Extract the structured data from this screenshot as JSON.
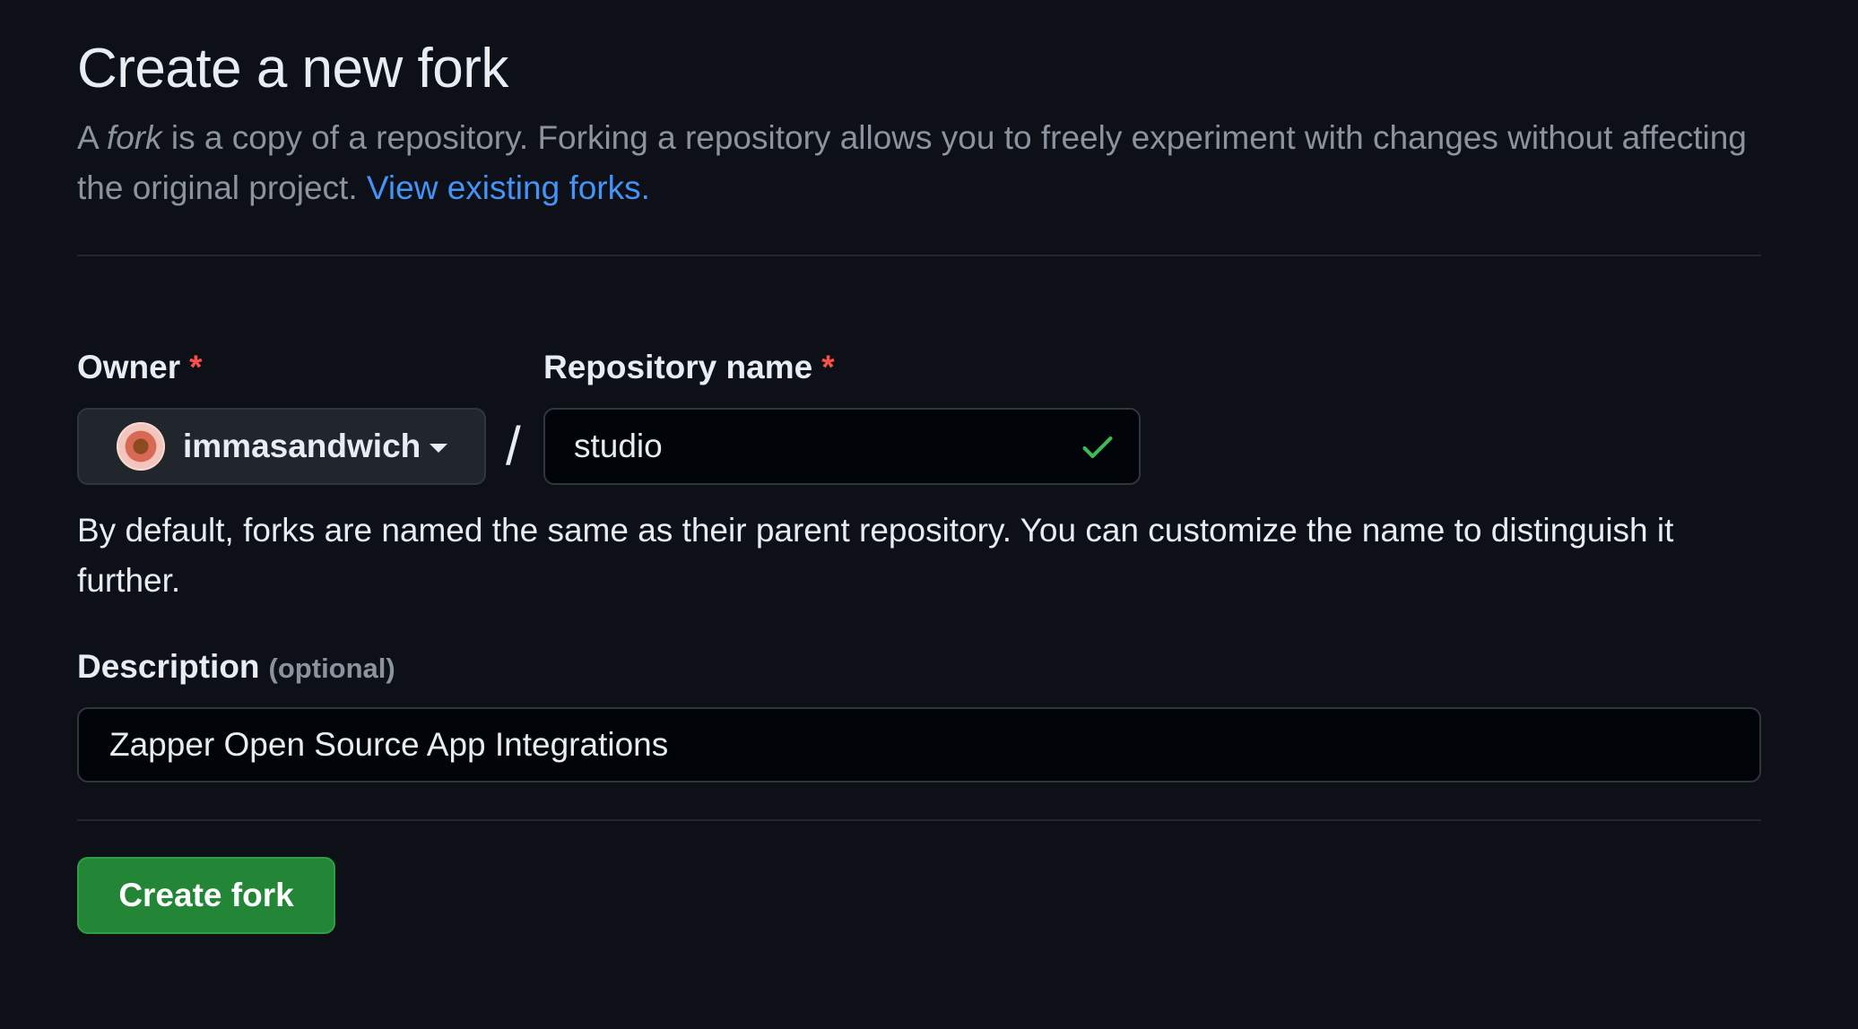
{
  "header": {
    "title": "Create a new fork",
    "subtitle_prefix": "A ",
    "subtitle_em": "fork",
    "subtitle_rest": " is a copy of a repository. Forking a repository allows you to freely experiment with changes without affecting the original project. ",
    "subtitle_link": "View existing forks."
  },
  "form": {
    "owner_label": "Owner",
    "repo_label": "Repository name",
    "required_marker": "*",
    "owner_value": "immasandwich",
    "separator": "/",
    "repo_value": "studio",
    "repo_status_icon": "check-icon",
    "hint": "By default, forks are named the same as their parent repository. You can customize the name to distinguish it further.",
    "description_label": "Description",
    "description_optional": "(optional)",
    "description_value": "Zapper Open Source App Integrations"
  },
  "actions": {
    "create_label": "Create fork"
  },
  "colors": {
    "background": "#0d1117",
    "link": "#4493f8",
    "required": "#f85149",
    "success": "#3fb950",
    "primary_button": "#238636"
  }
}
